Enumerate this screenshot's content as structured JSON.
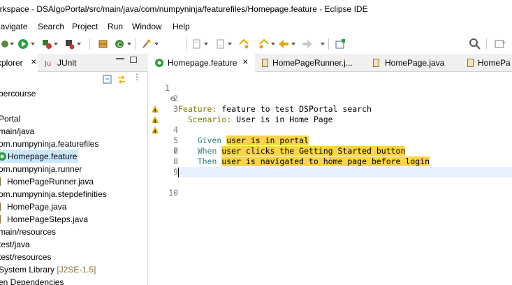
{
  "window": {
    "title": "orkspace - DSAlgoPortal/src/main/java/com/numpyninja/featurefiles/Homepage.feature - Eclipse IDE"
  },
  "menu": [
    "Navigate",
    "Search",
    "Project",
    "Run",
    "Window",
    "Help"
  ],
  "menu_partial_first": "lavigate",
  "toolbar": {
    "icons": [
      "debug-icon",
      "run-icon",
      "coverage-icon",
      "external-tools-icon",
      "new-java-package-icon",
      "new-class-icon",
      "search-open-type-icon",
      "next-annotation-icon",
      "prev-annotation-icon",
      "back-icon",
      "forward-icon",
      "pin-editor-icon",
      "search-icon"
    ]
  },
  "left_panel": {
    "tabs": [
      {
        "label": "xplorer",
        "active": true
      },
      {
        "label": "JUnit",
        "active": false
      }
    ],
    "tree": [
      {
        "label": "percourse",
        "muted": false
      },
      {
        "label": "",
        "muted": false
      },
      {
        "label": "Portal",
        "muted": false
      },
      {
        "label": "main/java",
        "muted": false
      },
      {
        "label": "om.numpyninja.featurefiles",
        "muted": false
      },
      {
        "label": "Homepage.feature",
        "muted": false,
        "selected": true
      },
      {
        "label": "om.numpyninja.runner",
        "muted": false
      },
      {
        "label": "HomePageRunner.java",
        "muted": false
      },
      {
        "label": "om.numpyninja.stepdefinities",
        "muted": false
      },
      {
        "label": "HomePage.java",
        "muted": false
      },
      {
        "label": "HomePageSteps.java",
        "muted": false
      },
      {
        "label": "main/resources",
        "muted": false
      },
      {
        "label": "test/java",
        "muted": false
      },
      {
        "label": "test/resources",
        "muted": false
      },
      {
        "label": "System Library ",
        "suffix": "[J2SE-1.5]",
        "muted": false
      },
      {
        "label": "en Dependencies",
        "muted": false
      }
    ]
  },
  "editor": {
    "tabs": [
      {
        "label": "Homepage.feature",
        "active": true,
        "close": "✕"
      },
      {
        "label": "HomePageRunner.j...",
        "active": false
      },
      {
        "label": "HomePage.java",
        "active": false
      },
      {
        "label": "HomePa",
        "active": false
      }
    ],
    "lines": [
      {
        "num": "1",
        "fold": "⊖",
        "parts": [
          {
            "t": "Feature:",
            "c": "kw-feature"
          },
          {
            "t": " feature to test DSPortal search",
            "c": ""
          }
        ]
      },
      {
        "num": "2",
        "parts": []
      },
      {
        "num": "3",
        "parts": [
          {
            "t": "  Scenario:",
            "c": "kw-scen"
          },
          {
            "t": " User is in Home Page",
            "c": ""
          }
        ]
      },
      {
        "num": "4",
        "warn": true,
        "parts": [
          {
            "t": "    Given ",
            "c": "kw-step"
          },
          {
            "t": "user is in portal",
            "c": "hl"
          }
        ]
      },
      {
        "num": "5",
        "warn": true,
        "parts": [
          {
            "t": "    When ",
            "c": "kw-step"
          },
          {
            "t": "user clicks the Getting Started button",
            "c": "hl"
          }
        ]
      },
      {
        "num": "6",
        "warn": true,
        "parts": [
          {
            "t": "    Then ",
            "c": "kw-step"
          },
          {
            "t": "user is navigated to home page before login",
            "c": "hl"
          }
        ]
      },
      {
        "num": "7",
        "parts": []
      },
      {
        "num": "8",
        "parts": []
      },
      {
        "num": "9",
        "parts": []
      },
      {
        "num": "10",
        "parts": [],
        "current": true
      }
    ]
  },
  "colors": {
    "highlight": "#f9d34a",
    "selection": "#cce8ff",
    "keyword": "#7a7a00",
    "step_keyword": "#2f7f7f"
  }
}
